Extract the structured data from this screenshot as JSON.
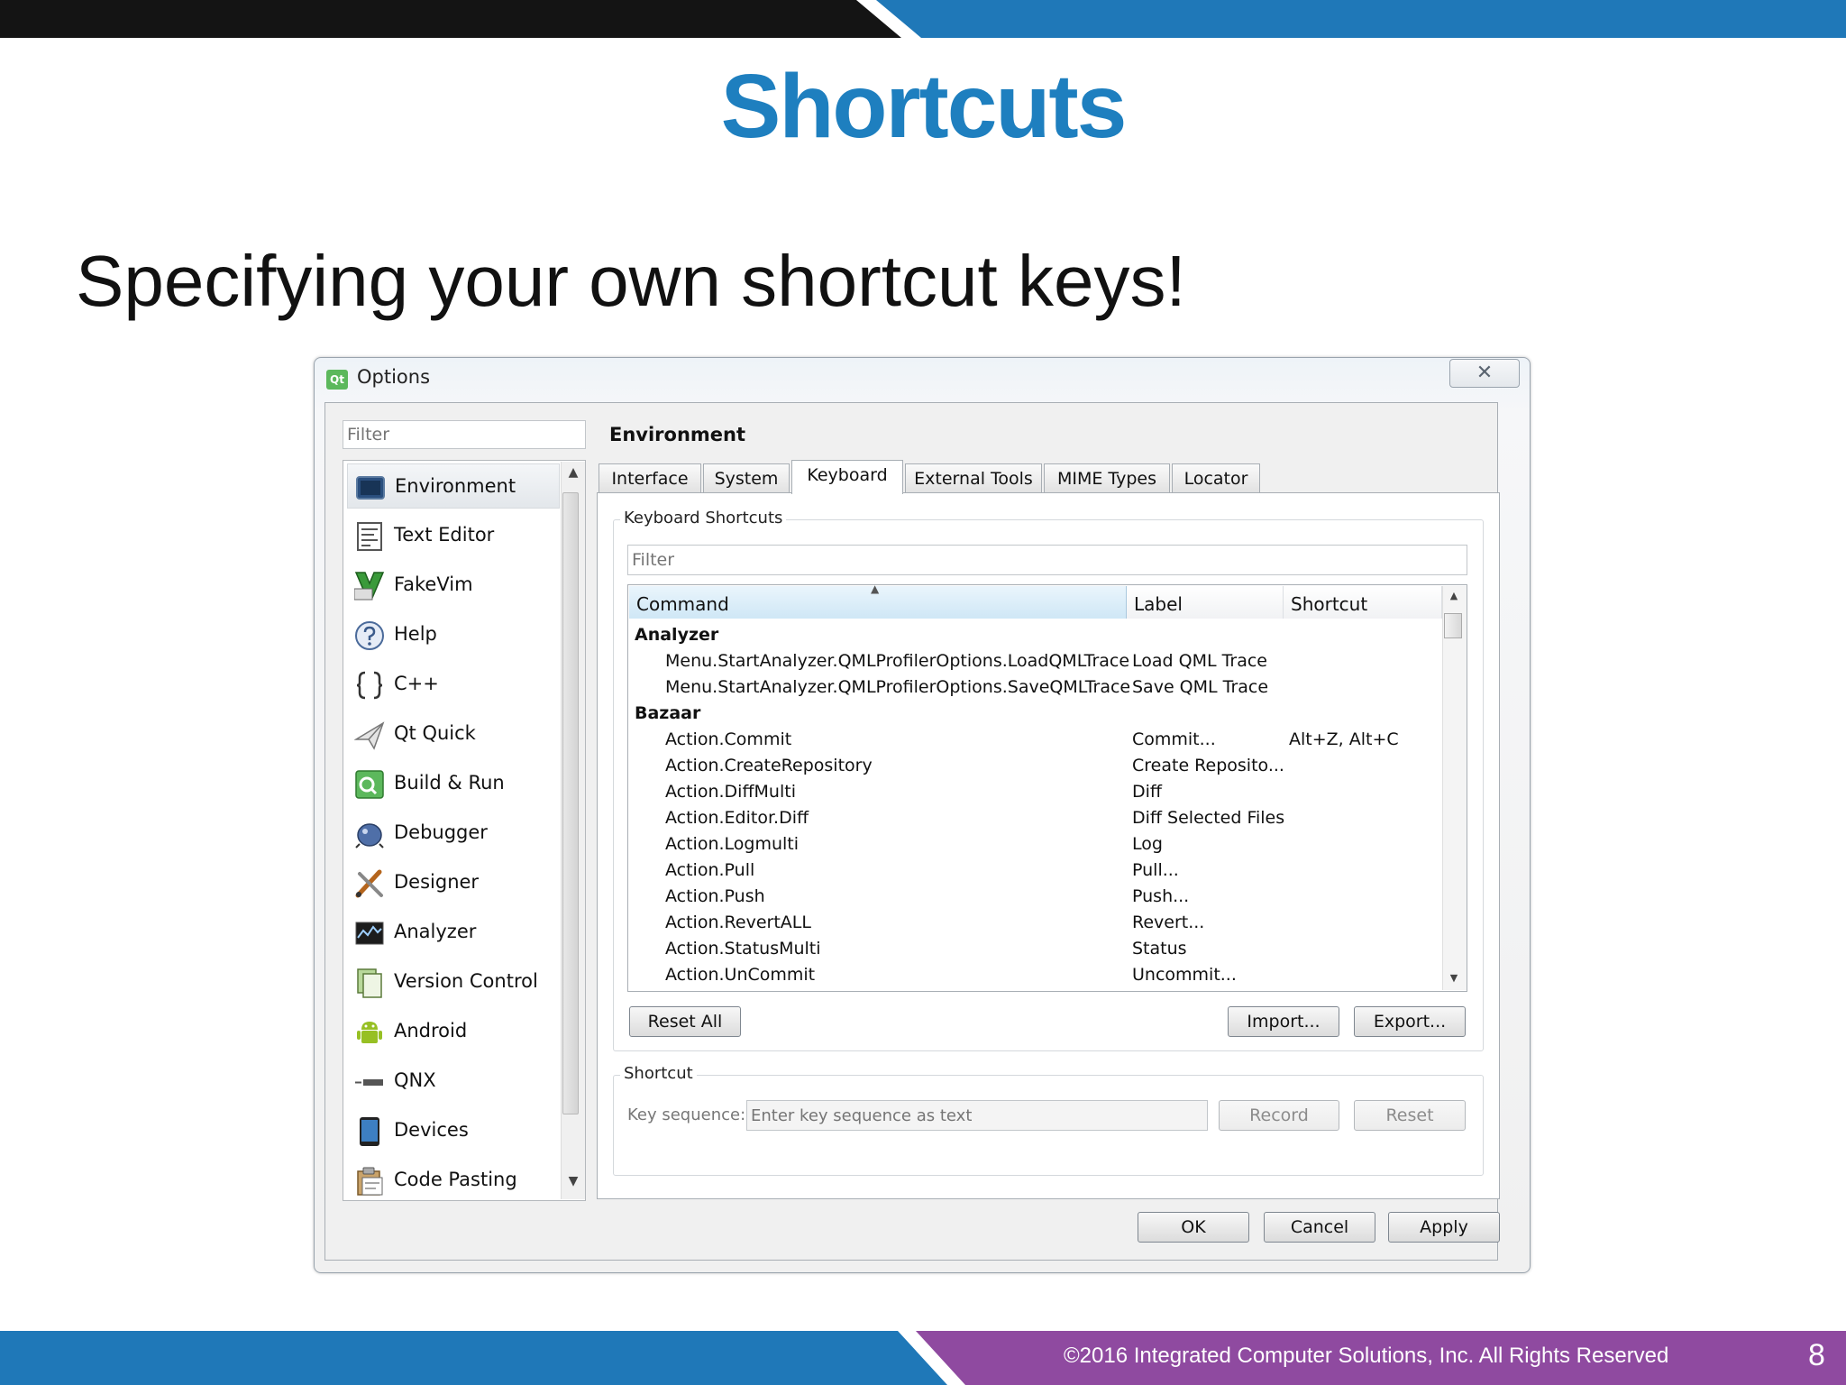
{
  "slide": {
    "title": "Shortcuts",
    "subtitle": "Specifying your own shortcut keys!",
    "footer": "©2016 Integrated Computer Solutions, Inc. All Rights Reserved",
    "page_number": "8",
    "colors": {
      "blue": "#1e7fbf",
      "purple": "#8f4aa0",
      "black": "#141414"
    }
  },
  "dialog": {
    "icon_text": "Qt",
    "title": "Options",
    "close_glyph": "✕",
    "sidebar": {
      "filter_placeholder": "Filter",
      "items": [
        {
          "label": "Environment",
          "icon": "monitor-icon",
          "selected": true
        },
        {
          "label": "Text Editor",
          "icon": "text-editor-icon"
        },
        {
          "label": "FakeVim",
          "icon": "fakevim-icon"
        },
        {
          "label": "Help",
          "icon": "help-icon"
        },
        {
          "label": "C++",
          "icon": "braces-icon"
        },
        {
          "label": "Qt Quick",
          "icon": "paper-plane-icon"
        },
        {
          "label": "Build & Run",
          "icon": "build-run-icon"
        },
        {
          "label": "Debugger",
          "icon": "debugger-icon"
        },
        {
          "label": "Designer",
          "icon": "designer-brush-icon"
        },
        {
          "label": "Analyzer",
          "icon": "analyzer-icon"
        },
        {
          "label": "Version Control",
          "icon": "version-control-icon"
        },
        {
          "label": "Android",
          "icon": "android-icon"
        },
        {
          "label": "QNX",
          "icon": "qnx-icon"
        },
        {
          "label": "Devices",
          "icon": "device-icon"
        },
        {
          "label": "Code Pasting",
          "icon": "code-pasting-icon"
        }
      ]
    },
    "section_title": "Environment",
    "tabs": [
      {
        "label": "Interface"
      },
      {
        "label": "System"
      },
      {
        "label": "Keyboard",
        "active": true
      },
      {
        "label": "External Tools"
      },
      {
        "label": "MIME Types"
      },
      {
        "label": "Locator"
      }
    ],
    "keyboard": {
      "group_title": "Keyboard Shortcuts",
      "filter_placeholder": "Filter",
      "columns": [
        "Command",
        "Label",
        "Shortcut"
      ],
      "rows": [
        {
          "command": "Analyzer",
          "label": "",
          "shortcut": "",
          "category": true
        },
        {
          "command": "Menu.StartAnalyzer.QMLProfilerOptions.LoadQMLTrace",
          "label": "Load QML Trace",
          "shortcut": ""
        },
        {
          "command": "Menu.StartAnalyzer.QMLProfilerOptions.SaveQMLTrace",
          "label": "Save QML Trace",
          "shortcut": ""
        },
        {
          "command": "Bazaar",
          "label": "",
          "shortcut": "",
          "category": true
        },
        {
          "command": "Action.Commit",
          "label": "Commit...",
          "shortcut": "Alt+Z, Alt+C"
        },
        {
          "command": "Action.CreateRepository",
          "label": "Create Reposito...",
          "shortcut": ""
        },
        {
          "command": "Action.DiffMulti",
          "label": "Diff",
          "shortcut": ""
        },
        {
          "command": "Action.Editor.Diff",
          "label": "Diff Selected Files",
          "shortcut": ""
        },
        {
          "command": "Action.Logmulti",
          "label": "Log",
          "shortcut": ""
        },
        {
          "command": "Action.Pull",
          "label": "Pull...",
          "shortcut": ""
        },
        {
          "command": "Action.Push",
          "label": "Push...",
          "shortcut": ""
        },
        {
          "command": "Action.RevertALL",
          "label": "Revert...",
          "shortcut": ""
        },
        {
          "command": "Action.StatusMulti",
          "label": "Status",
          "shortcut": ""
        },
        {
          "command": "Action.UnCommit",
          "label": "Uncommit...",
          "shortcut": ""
        }
      ],
      "reset_all_label": "Reset All",
      "import_label": "Import...",
      "export_label": "Export..."
    },
    "shortcut": {
      "group_title": "Shortcut",
      "key_sequence_label": "Key sequence:",
      "key_sequence_placeholder": "Enter key sequence as text",
      "record_label": "Record",
      "reset_label": "Reset"
    },
    "buttons": {
      "ok": "OK",
      "cancel": "Cancel",
      "apply": "Apply"
    }
  }
}
